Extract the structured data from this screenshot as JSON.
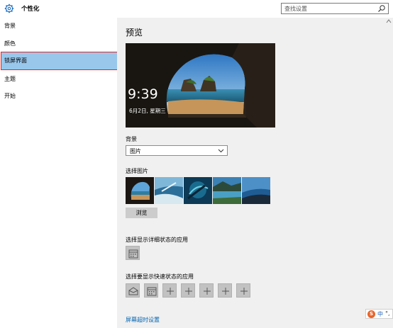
{
  "header": {
    "title": "个性化"
  },
  "search": {
    "placeholder": "查找设置"
  },
  "sidebar": {
    "items": [
      {
        "label": "背景"
      },
      {
        "label": "颜色"
      },
      {
        "label": "锁屏界面"
      },
      {
        "label": "主题"
      },
      {
        "label": "开始"
      }
    ]
  },
  "main": {
    "preview_title": "预览",
    "preview_time": "9:39",
    "preview_date": "6月2日, 星期三",
    "background_label": "背景",
    "background_value": "图片",
    "choose_picture_label": "选择图片",
    "browse_label": "浏览",
    "detailed_status_label": "选择显示详细状态的应用",
    "quick_status_label": "选择要显示快速状态的应用",
    "plus_glyph": "+",
    "timeout_link": "屏幕超时设置"
  },
  "ime": {
    "logo": "S",
    "mode": "中",
    "extra": "°,"
  },
  "colors": {
    "accent": "#0063b1",
    "selected_bg": "#99c7ec",
    "selected_border": "#e0262a"
  },
  "icons": [
    "gear-icon",
    "search-icon",
    "chevron-down-icon",
    "calendar-icon",
    "mail-icon",
    "plus-icon"
  ]
}
